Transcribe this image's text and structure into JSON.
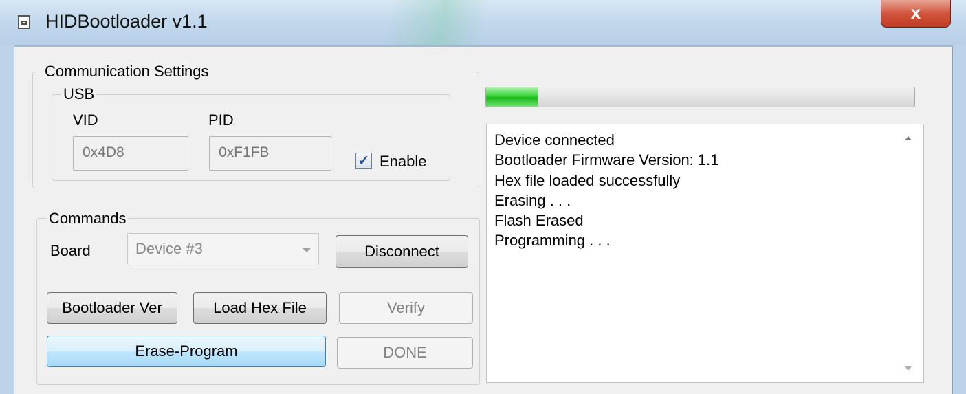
{
  "window": {
    "title": "HIDBootloader v1.1",
    "close_label": "x"
  },
  "communication_settings": {
    "legend": "Communication Settings",
    "usb": {
      "legend": "USB",
      "vid_label": "VID",
      "vid_value": "0x4D8",
      "pid_label": "PID",
      "pid_value": "0xF1FB",
      "enable_label": "Enable",
      "enable_checked": true,
      "check_glyph": "✓"
    }
  },
  "commands": {
    "legend": "Commands",
    "board_label": "Board",
    "board_selected": "Device #3",
    "disconnect_label": "Disconnect",
    "bootloader_ver_label": "Bootloader Ver",
    "load_hex_label": "Load Hex File",
    "verify_label": "Verify",
    "erase_program_label": "Erase-Program",
    "done_label": "DONE"
  },
  "progress": {
    "value_percent": 12,
    "color": "#22c022"
  },
  "log": {
    "lines": [
      "Device connected",
      "Bootloader Firmware Version: 1.1",
      "Hex file loaded successfully",
      "Erasing . . .",
      "Flash Erased",
      "Programming . . ."
    ]
  }
}
